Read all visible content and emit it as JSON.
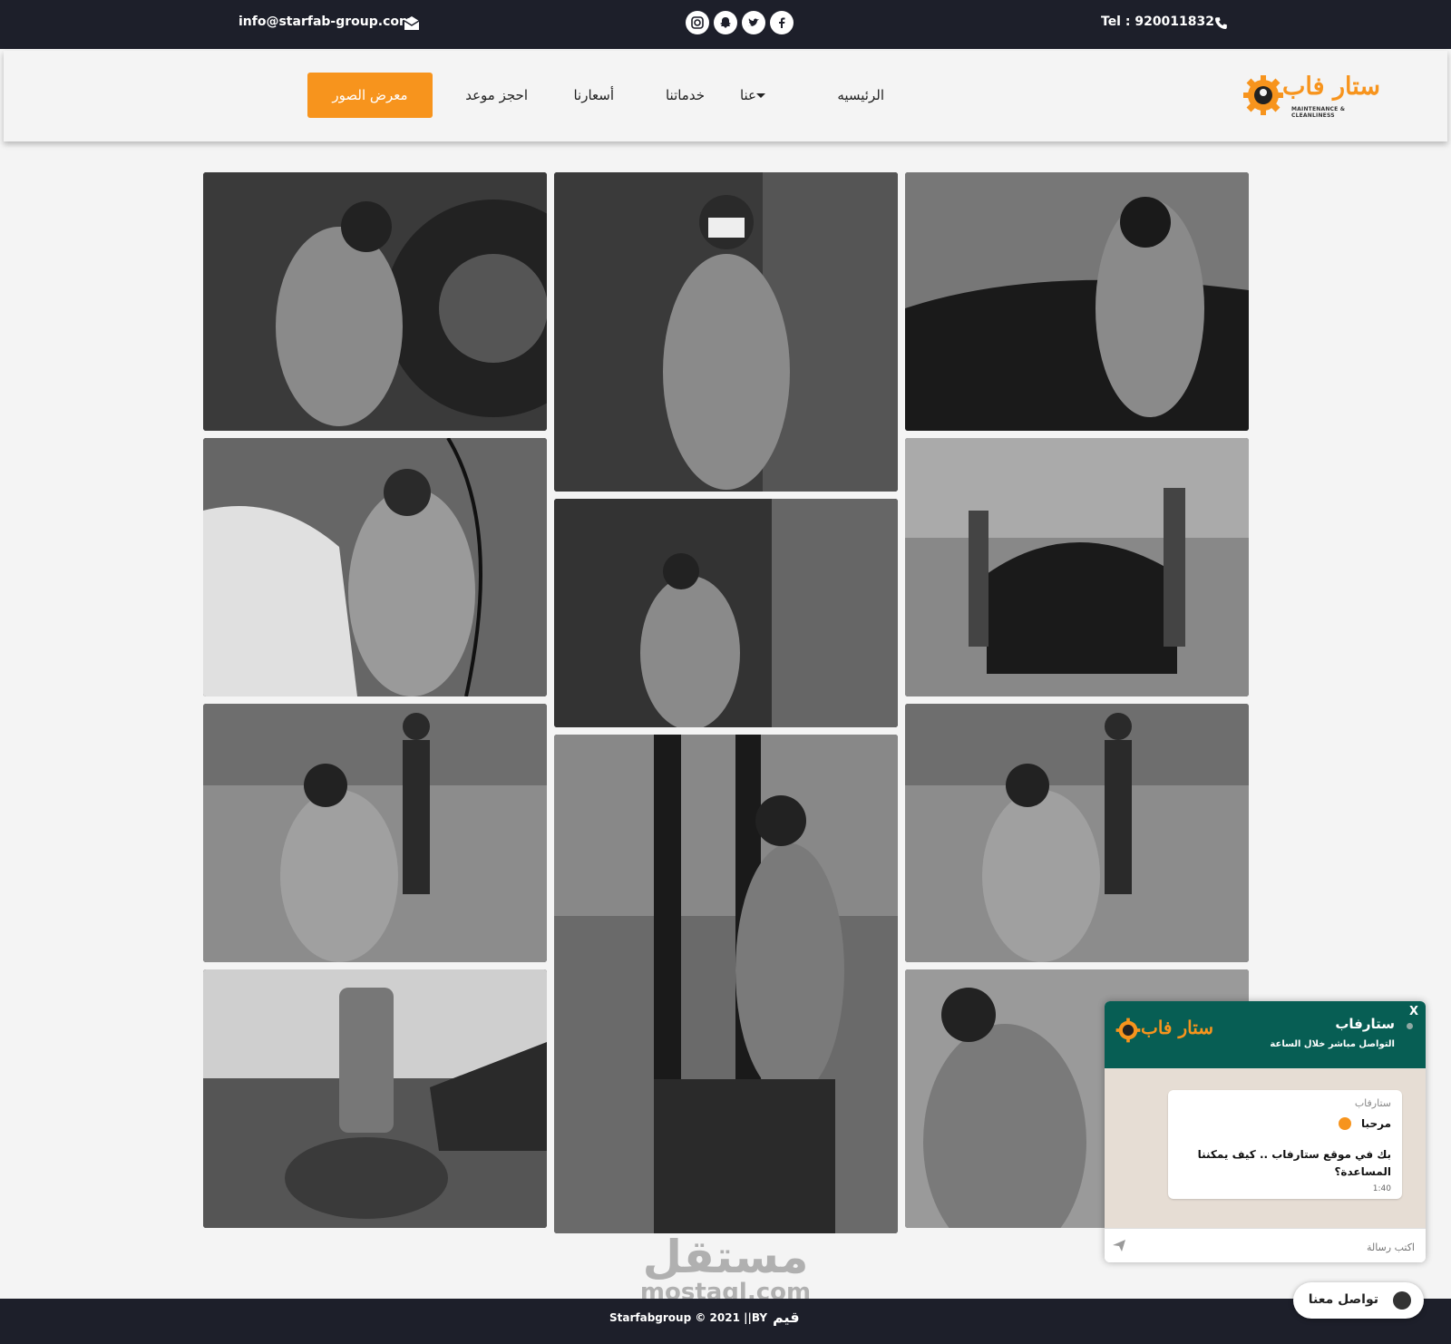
{
  "topbar": {
    "email": "info@starfab-group.com",
    "phone": "Tel : 920011832",
    "socials": [
      "instagram-icon",
      "snapchat-icon",
      "twitter-icon",
      "facebook-icon"
    ]
  },
  "navbar": {
    "logo_text": "ستار فاب",
    "logo_tagline": "MAINTENANCE & CLEANLINESS",
    "home": "الرئيسيه",
    "about": "عنا",
    "services": "خدماتنا",
    "prices": "أسعارنا",
    "book": "احجز موعد",
    "gallery": "معرض الصور"
  },
  "watermark": {
    "arabic": "مستقل",
    "latin": "mostaql.com"
  },
  "footer": {
    "copyright": "Starfabgroup © 2021 ||BY",
    "maker": "قيم"
  },
  "chat": {
    "title": "ستارفاب",
    "subtitle": "التواصل مباشر خلال الساعة",
    "close": "X",
    "logo_text": "ستار فاب",
    "sender": "ستارفاب",
    "hello": "مرحبا",
    "message": "بك في موقع ستارفاب .. كيف يمكننا المساعدة؟",
    "time": "1:40",
    "placeholder": "اكتب رسالة",
    "contact_button": "تواصل معنا"
  },
  "colors": {
    "dark_bar": "#1d1f2a",
    "accent": "#f7941d",
    "chat_header": "#075e54"
  }
}
